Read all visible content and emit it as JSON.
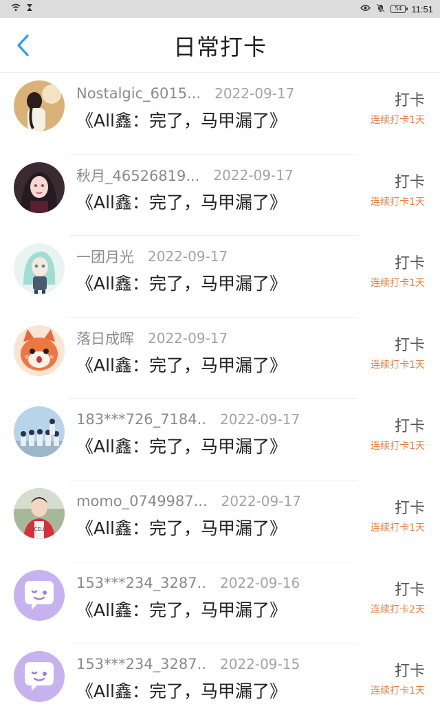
{
  "status_bar": {
    "time": "11:51",
    "battery": "54",
    "icons": [
      "wifi-icon",
      "hourglass-icon",
      "eye-icon",
      "mute-bell-icon",
      "battery-icon"
    ]
  },
  "header": {
    "title": "日常打卡",
    "back_icon": "chevron-left-icon",
    "accent": "#2a9df4"
  },
  "colors": {
    "streak": "#ee7b3a",
    "name": "#8a8a8a",
    "date": "#a3a3a3"
  },
  "items": [
    {
      "name": "Nostalgic_6015...",
      "date": "2022-09-17",
      "book": "《All鑫：完了，马甲漏了》",
      "action": "打卡",
      "streak": "连续打卡1天",
      "avatar": "girl-photo-avatar"
    },
    {
      "name": "秋月_46526819...",
      "date": "2022-09-17",
      "book": "《All鑫：完了，马甲漏了》",
      "action": "打卡",
      "streak": "连续打卡1天",
      "avatar": "anime-girl-avatar"
    },
    {
      "name": "一团月光",
      "date": "2022-09-17",
      "book": "《All鑫：完了，马甲漏了》",
      "action": "打卡",
      "streak": "连续打卡1天",
      "avatar": "anime-character-avatar"
    },
    {
      "name": "落日成晖",
      "date": "2022-09-17",
      "book": "《All鑫：完了，马甲漏了》",
      "action": "打卡",
      "streak": "连续打卡1天",
      "avatar": "cartoon-fox-avatar"
    },
    {
      "name": "183***726_7184..",
      "date": "2022-09-17",
      "book": "《All鑫：完了，马甲漏了》",
      "action": "打卡",
      "streak": "连续打卡1天",
      "avatar": "group-photo-avatar"
    },
    {
      "name": "momo_0749987...",
      "date": "2022-09-17",
      "book": "《All鑫：完了，马甲漏了》",
      "action": "打卡",
      "streak": "连续打卡1天",
      "avatar": "boy-photo-avatar"
    },
    {
      "name": "153***234_3287..",
      "date": "2022-09-16",
      "book": "《All鑫：完了，马甲漏了》",
      "action": "打卡",
      "streak": "连续打卡2天",
      "avatar": "default-chat-avatar"
    },
    {
      "name": "153***234_3287..",
      "date": "2022-09-15",
      "book": "《All鑫：完了，马甲漏了》",
      "action": "打卡",
      "streak": "连续打卡1天",
      "avatar": "default-chat-avatar"
    }
  ]
}
